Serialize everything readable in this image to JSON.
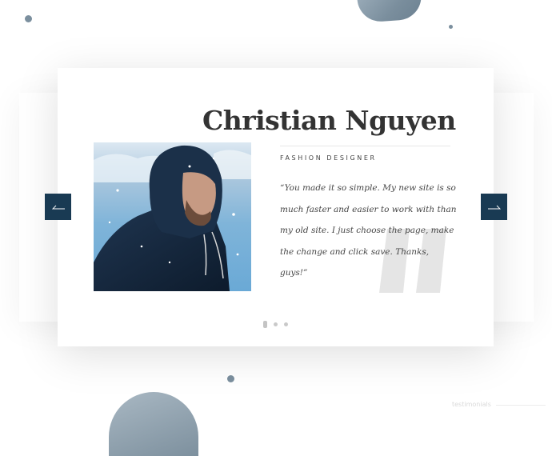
{
  "testimonial": {
    "name": "Christian Nguyen",
    "role": "FASHION DESIGNER",
    "quote": "“You made it so simple. My new site is so much faster and easier to work with than my old site. I just choose the page, make the change and click save. Thanks, guys!”"
  },
  "navigation": {
    "prev_icon": "arrow-left-icon",
    "next_icon": "arrow-right-icon",
    "pager_count": 3,
    "active_index": 0
  },
  "footer": {
    "label": "testimonials"
  },
  "colors": {
    "accent": "#193a53",
    "name_text": "#333333",
    "body_text": "#444444",
    "quote_mark": "#e5e5e5",
    "dot": "#6e8494"
  }
}
